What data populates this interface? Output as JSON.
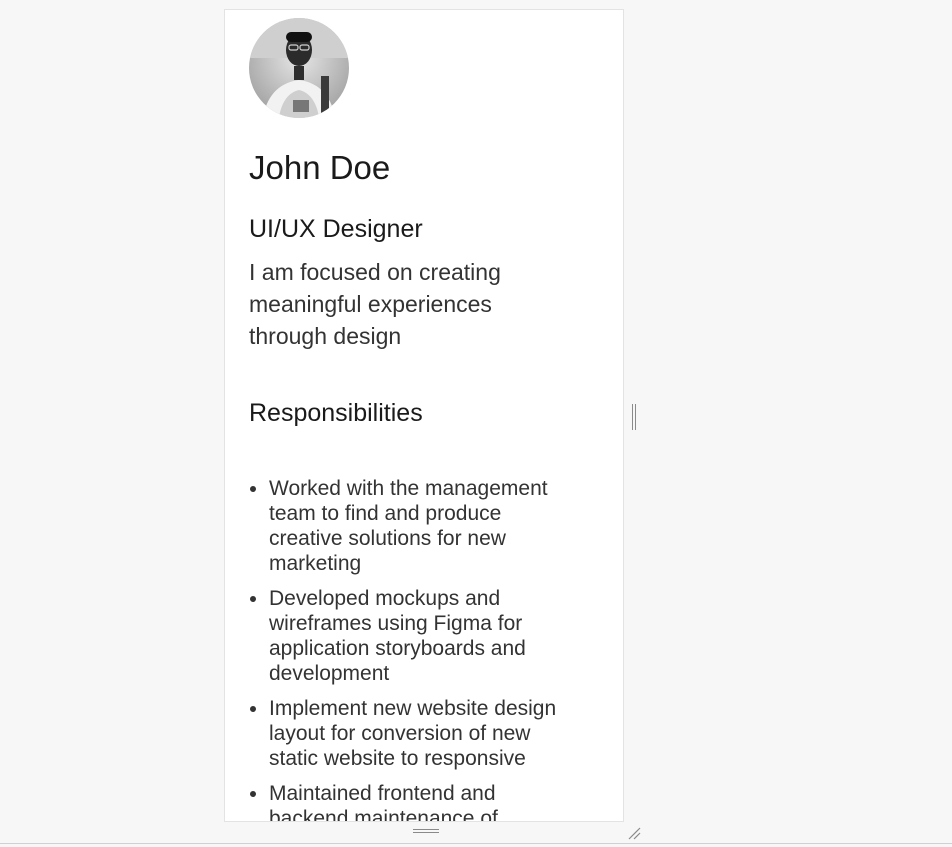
{
  "profile": {
    "name": "John Doe",
    "role": "UI/UX Designer",
    "tagline": "I am focused on creating meaningful experiences through design",
    "avatar_icon": "person-photo"
  },
  "responsibilities": {
    "heading": "Responsibilities",
    "items": [
      "Worked with the management team to find and produce creative solutions for new marketing",
      "Developed mockups and wireframes using Figma for application storyboards and development",
      "Implement new website design layout for conversion of new static website to responsive",
      "Maintained frontend and backend maintenance of"
    ]
  },
  "colors": {
    "page_background": "#f7f7f7",
    "card_background": "#ffffff",
    "text": "#222222"
  }
}
